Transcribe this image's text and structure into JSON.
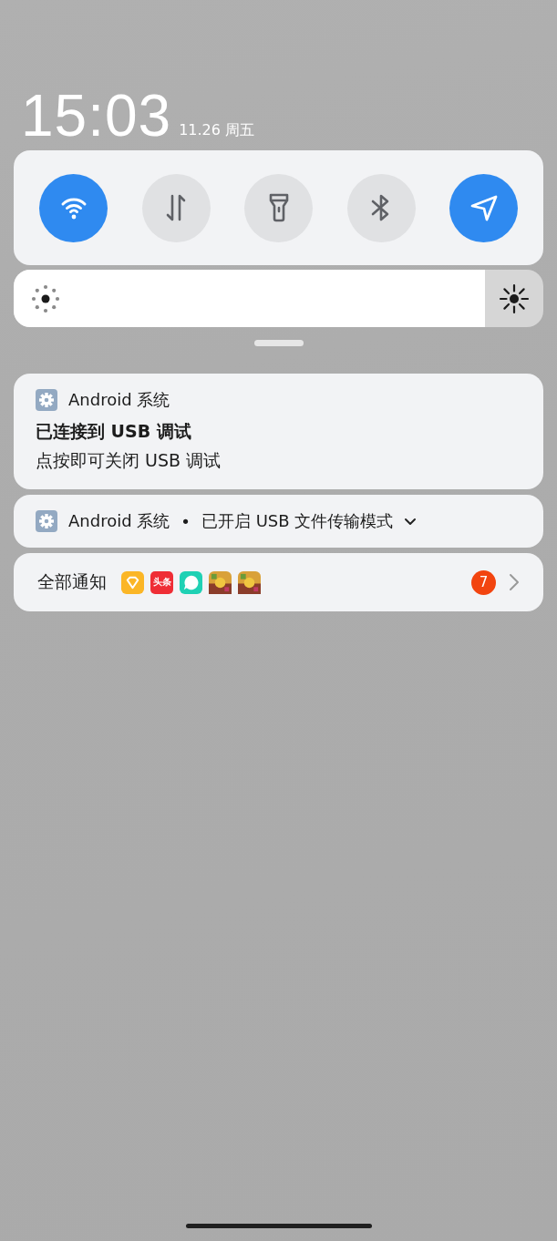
{
  "clock": {
    "time": "15:03",
    "date": "11.26 周五"
  },
  "quick_tiles": [
    {
      "kind": "wifi",
      "on": true
    },
    {
      "kind": "data",
      "on": false
    },
    {
      "kind": "flashlight",
      "on": false
    },
    {
      "kind": "bluetooth",
      "on": false
    },
    {
      "kind": "location",
      "on": true
    }
  ],
  "notifications": [
    {
      "kind": "expanded",
      "app": "Android 系统",
      "title": "已连接到 USB 调试",
      "text": "点按即可关闭 USB 调试"
    },
    {
      "kind": "collapsed",
      "app": "Android 系统",
      "separator": "•",
      "text": "已开启 USB 文件传输模式"
    }
  ],
  "all_notifications": {
    "label": "全部通知",
    "apps": [
      {
        "kind": "diamond"
      },
      {
        "kind": "text",
        "label": "头条"
      },
      {
        "kind": "chat"
      },
      {
        "kind": "picture"
      },
      {
        "kind": "picture"
      }
    ],
    "count": "7"
  }
}
